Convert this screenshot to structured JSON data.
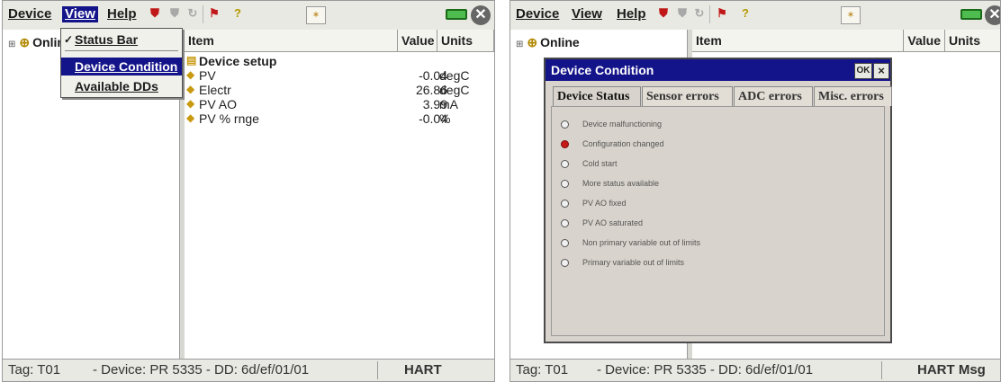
{
  "colors": {
    "accent": "#14148a",
    "led_on": "#c81818",
    "battery": "#4ebc4e"
  },
  "left": {
    "menu": {
      "device": "Device",
      "view": "View",
      "help": "Help"
    },
    "toolbar_icons": [
      "red-device-icon",
      "gray-device-icon",
      "gray-refresh-icon",
      "red-flag-icon",
      "yellow-help-icon"
    ],
    "tree": {
      "root_label": "Online"
    },
    "dropdown": {
      "status_bar": "Status Bar",
      "device_condition": "Device Condition",
      "available_dds": "Available DDs"
    },
    "table": {
      "headers": {
        "item": "Item",
        "value": "Value",
        "units": "Units"
      },
      "rows": [
        {
          "item": "Device setup",
          "value": "",
          "unit": ""
        },
        {
          "item": "PV",
          "value": "-0.04",
          "unit": "degC"
        },
        {
          "item": "Electr",
          "value": "26.86",
          "unit": "degC"
        },
        {
          "item": "PV AO",
          "value": "3.99",
          "unit": "mA"
        },
        {
          "item": "PV % rnge",
          "value": "-0.04",
          "unit": "%"
        }
      ]
    },
    "statusbar": {
      "tag": "Tag: T01",
      "device": "- Device: PR 5335 - DD: 6d/ef/01/01",
      "protocol": "HART"
    }
  },
  "right": {
    "menu": {
      "device": "Device",
      "view": "View",
      "help": "Help"
    },
    "tree": {
      "root_label": "Online"
    },
    "table": {
      "headers": {
        "item": "Item",
        "value": "Value",
        "units": "Units"
      }
    },
    "dialog": {
      "title": "Device Condition",
      "ok": "OK",
      "close": "×",
      "tabs": [
        "Device Status",
        "Sensor errors",
        "ADC errors",
        "Misc. errors"
      ],
      "status_items": [
        {
          "label": "Device malfunctioning",
          "on": false
        },
        {
          "label": "Configuration changed",
          "on": true
        },
        {
          "label": "Cold start",
          "on": false
        },
        {
          "label": "More status available",
          "on": false
        },
        {
          "label": "PV AO fixed",
          "on": false
        },
        {
          "label": "PV AO saturated",
          "on": false
        },
        {
          "label": "Non primary variable out of limits",
          "on": false
        },
        {
          "label": "Primary variable out of limits",
          "on": false
        }
      ]
    },
    "statusbar": {
      "tag": "Tag: T01",
      "device": "- Device: PR 5335 - DD: 6d/ef/01/01",
      "protocol": "HART Msg"
    }
  }
}
